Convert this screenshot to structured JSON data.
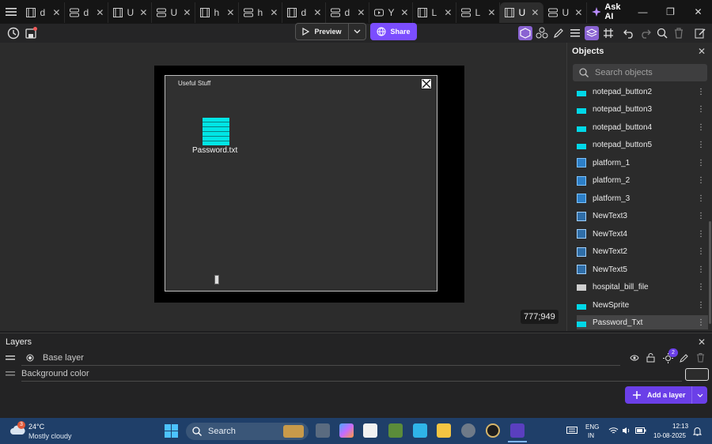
{
  "tabs": [
    {
      "label": "d",
      "icon": "film-icon"
    },
    {
      "label": "d",
      "icon": "layers-icon"
    },
    {
      "label": "U",
      "icon": "film-icon"
    },
    {
      "label": "U",
      "icon": "layers-icon"
    },
    {
      "label": "h",
      "icon": "film-icon"
    },
    {
      "label": "h",
      "icon": "layers-icon"
    },
    {
      "label": "d",
      "icon": "film-icon"
    },
    {
      "label": "d",
      "icon": "layers-icon"
    },
    {
      "label": "Y",
      "icon": "youtube-icon"
    },
    {
      "label": "L",
      "icon": "film-icon"
    },
    {
      "label": "L",
      "icon": "layers-icon"
    },
    {
      "label": "U",
      "icon": "film-icon",
      "active": true
    },
    {
      "label": "U",
      "icon": "layers-icon"
    }
  ],
  "ask_ai": "Ask AI",
  "toolbar": {
    "preview_label": "Preview",
    "share_label": "Share"
  },
  "canvas": {
    "game_title": "Useful Stuff",
    "file_label": "Password.txt",
    "cursor_coords": "777;949"
  },
  "objects_panel": {
    "title": "Objects",
    "search_placeholder": "Search objects",
    "items": [
      {
        "name": "notepad_button2",
        "icon": "sprite"
      },
      {
        "name": "notepad_button3",
        "icon": "sprite"
      },
      {
        "name": "notepad_button4",
        "icon": "sprite"
      },
      {
        "name": "notepad_button5",
        "icon": "sprite"
      },
      {
        "name": "platform_1",
        "icon": "tiled"
      },
      {
        "name": "platform_2",
        "icon": "tiled"
      },
      {
        "name": "platform_3",
        "icon": "tiled"
      },
      {
        "name": "NewText3",
        "icon": "text"
      },
      {
        "name": "NewText4",
        "icon": "text"
      },
      {
        "name": "NewText2",
        "icon": "text"
      },
      {
        "name": "NewText5",
        "icon": "text"
      },
      {
        "name": "hospital_bill_file",
        "icon": "gray"
      },
      {
        "name": "NewSprite",
        "icon": "sprite"
      },
      {
        "name": "Password_Txt",
        "icon": "sprite",
        "selected": true
      }
    ]
  },
  "layers_panel": {
    "title": "Layers",
    "base_layer": "Base layer",
    "background_color": "Background color",
    "add_layer_label": "Add a layer",
    "lights_badge": "2"
  },
  "taskbar": {
    "weather_temp": "24°C",
    "weather_desc": "Mostly cloudy",
    "weather_badge": "3",
    "search_placeholder": "Search",
    "lang_line1": "ENG",
    "lang_line2": "IN",
    "time": "12:13",
    "date": "10-08-2025"
  }
}
